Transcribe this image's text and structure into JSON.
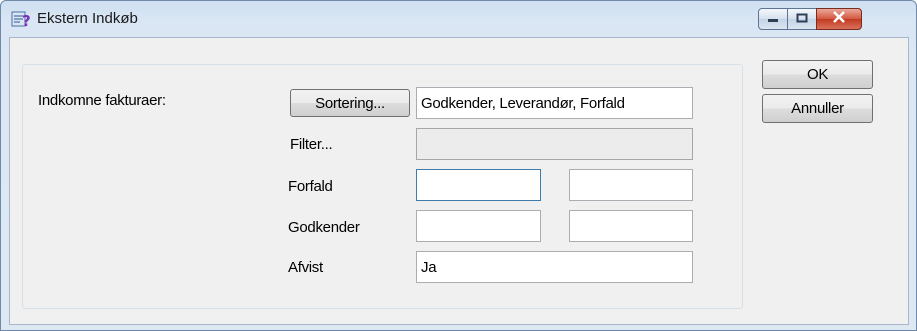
{
  "window": {
    "title": "Ekstern Indkøb",
    "minimize_icon": "minimize-icon",
    "maximize_icon": "maximize-icon",
    "close_icon": "close-icon",
    "app_icon": "app-icon"
  },
  "form": {
    "incoming_label": "Indkomne fakturaer:",
    "sort_button": "Sortering...",
    "sort_value": "Godkender, Leverandør, Forfald",
    "filter_label": "Filter...",
    "filter_value": "",
    "due_label": "Forfald",
    "due_from": "",
    "due_to": "",
    "approver_label": "Godkender",
    "approver_from": "",
    "approver_to": "",
    "rejected_label": "Afvist",
    "rejected_value": "Ja"
  },
  "actions": {
    "ok": "OK",
    "cancel": "Annuller"
  },
  "colors": {
    "close_red": "#c23a22",
    "focus_blue": "#3d7bad"
  }
}
